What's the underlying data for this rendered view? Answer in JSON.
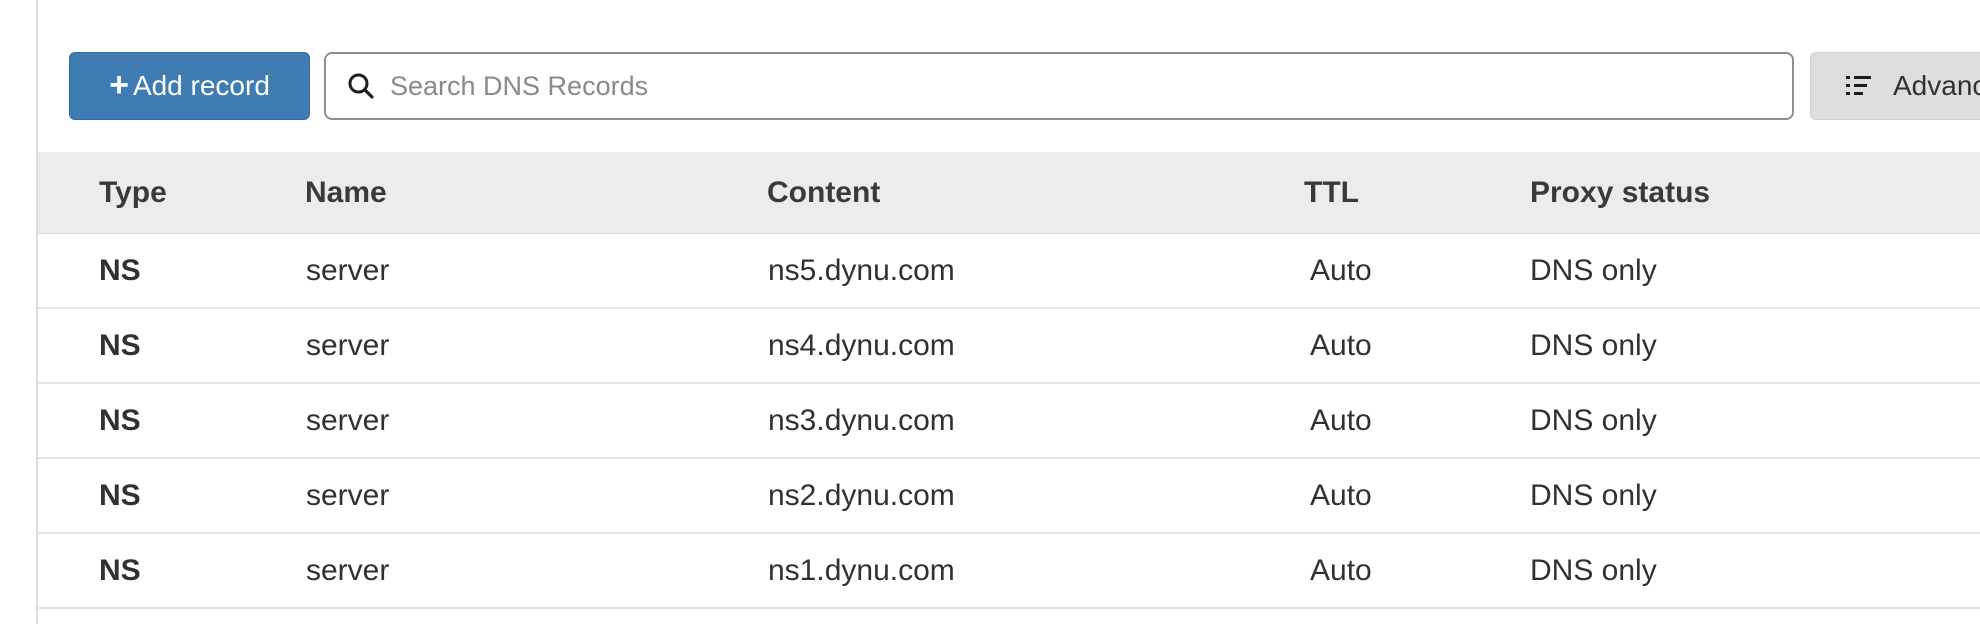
{
  "toolbar": {
    "add_record_label": "Add record",
    "add_record_icon": "plus-icon",
    "search_placeholder": "Search DNS Records",
    "search_value": "",
    "search_icon": "search-icon",
    "advanced_label": "Advanced",
    "advanced_icon": "list-icon"
  },
  "table": {
    "headers": {
      "type": "Type",
      "name": "Name",
      "content": "Content",
      "ttl": "TTL",
      "proxy_status": "Proxy status"
    },
    "rows": [
      {
        "type": "NS",
        "name": "server",
        "content": "ns5.dynu.com",
        "ttl": "Auto",
        "proxy_status": "DNS only"
      },
      {
        "type": "NS",
        "name": "server",
        "content": "ns4.dynu.com",
        "ttl": "Auto",
        "proxy_status": "DNS only"
      },
      {
        "type": "NS",
        "name": "server",
        "content": "ns3.dynu.com",
        "ttl": "Auto",
        "proxy_status": "DNS only"
      },
      {
        "type": "NS",
        "name": "server",
        "content": "ns2.dynu.com",
        "ttl": "Auto",
        "proxy_status": "DNS only"
      },
      {
        "type": "NS",
        "name": "server",
        "content": "ns1.dynu.com",
        "ttl": "Auto",
        "proxy_status": "DNS only"
      }
    ]
  },
  "colors": {
    "primary_button": "#3f7cb3",
    "header_bg": "#ebecec",
    "secondary_button": "#dcdedf"
  }
}
